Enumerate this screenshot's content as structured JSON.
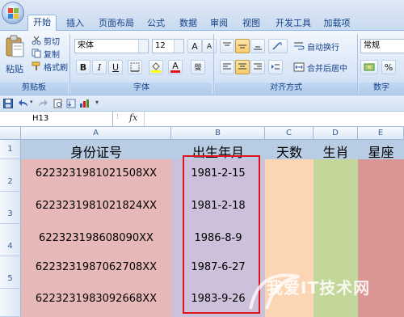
{
  "ribbon": {
    "tabs": [
      "开始",
      "插入",
      "页面布局",
      "公式",
      "数据",
      "审阅",
      "视图",
      "开发工具",
      "加载项"
    ],
    "active_tab": "开始",
    "clipboard": {
      "paste": "粘贴",
      "cut": "剪切",
      "copy": "复制",
      "format_painter": "格式刷",
      "group_label": "剪贴板"
    },
    "font": {
      "name": "宋体",
      "size": "12",
      "grow": "A",
      "shrink": "A",
      "wen": "燮",
      "bold": "B",
      "italic": "I",
      "underline": "U",
      "color_glyph": "A",
      "group_label": "字体"
    },
    "alignment": {
      "wrap_text": "自动换行",
      "merge_center": "合并后居中",
      "group_label": "对齐方式"
    },
    "number": {
      "format": "常规",
      "percent": "%",
      "group_label": "数字"
    }
  },
  "formula_bar": {
    "name_box": "H13",
    "fx_label": "fx",
    "value": ""
  },
  "sheet": {
    "columns": [
      "A",
      "B",
      "C",
      "D",
      "E"
    ],
    "rows": [
      "1",
      "2",
      "3",
      "4",
      "5"
    ],
    "headers": [
      "身份证号",
      "出生年月",
      "天数",
      "生肖",
      "星座"
    ],
    "data": [
      {
        "id": "6223231981021508XX",
        "birth": "1981-2-15"
      },
      {
        "id": "6223231981021824XX",
        "birth": "1981-2-18"
      },
      {
        "id": "622323198608090XX",
        "birth": "1986-8-9"
      },
      {
        "id": "6223231987062708XX",
        "birth": "1987-6-27"
      },
      {
        "id": "6223231983092668XX",
        "birth": "1983-9-26"
      }
    ]
  },
  "colors": {
    "header_row": "#b8cce4",
    "col_a": "#e6b8b7",
    "col_b": "#ccc0da",
    "col_c": "#fcd5b4",
    "col_d": "#c4d79b",
    "col_e": "#da9694",
    "highlight": "#e0151b"
  },
  "watermark": "我爱IT技术网"
}
